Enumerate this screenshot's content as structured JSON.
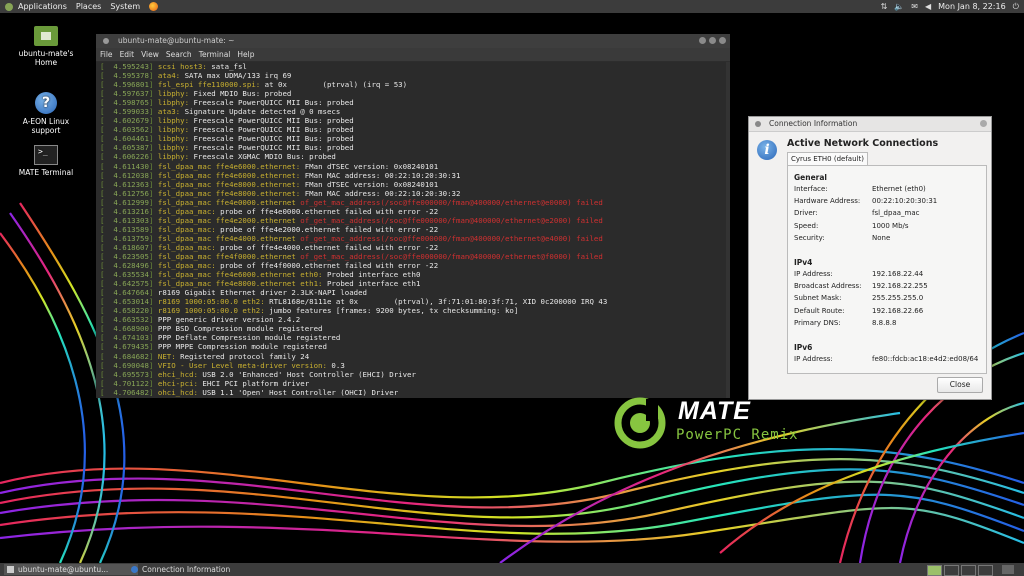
{
  "top_panel": {
    "menus": [
      "Applications",
      "Places",
      "System"
    ],
    "clock": "Mon Jan  8, 22:16"
  },
  "desktop_icons": [
    {
      "label": "ubuntu-mate's Home",
      "icon": "home-folder-icon"
    },
    {
      "label": "A-EON Linux support",
      "icon": "help-icon"
    },
    {
      "label": "MATE Terminal",
      "icon": "terminal-icon"
    }
  ],
  "terminal": {
    "title": "ubuntu-mate@ubuntu-mate: ~",
    "menu": [
      "File",
      "Edit",
      "View",
      "Search",
      "Terminal",
      "Help"
    ],
    "lines": [
      {
        "ts": "4.595243",
        "mod": "scsi host3:",
        "msg": " sata_fsl",
        "err": ""
      },
      {
        "ts": "4.595378",
        "mod": "ata4:",
        "msg": " SATA max UDMA/133 irq 69",
        "err": ""
      },
      {
        "ts": "4.596801",
        "mod": "fsl_espi ffe110000.spi:",
        "msg": " at 0x        (ptrval) (irq = 53)",
        "err": ""
      },
      {
        "ts": "4.597637",
        "mod": "libphy:",
        "msg": " Fixed MDIO Bus: probed",
        "err": ""
      },
      {
        "ts": "4.598765",
        "mod": "libphy:",
        "msg": " Freescale PowerQUICC MII Bus: probed",
        "err": ""
      },
      {
        "ts": "4.599033",
        "mod": "ata3:",
        "msg": " Signature Update detected @ 0 msecs",
        "err": ""
      },
      {
        "ts": "4.602679",
        "mod": "libphy:",
        "msg": " Freescale PowerQUICC MII Bus: probed",
        "err": ""
      },
      {
        "ts": "4.603562",
        "mod": "libphy:",
        "msg": " Freescale PowerQUICC MII Bus: probed",
        "err": ""
      },
      {
        "ts": "4.604461",
        "mod": "libphy:",
        "msg": " Freescale PowerQUICC MII Bus: probed",
        "err": ""
      },
      {
        "ts": "4.605387",
        "mod": "libphy:",
        "msg": " Freescale PowerQUICC MII Bus: probed",
        "err": ""
      },
      {
        "ts": "4.606226",
        "mod": "libphy:",
        "msg": " Freescale XGMAC MDIO Bus: probed",
        "err": ""
      },
      {
        "ts": "4.611430",
        "mod": "fsl_dpaa_mac ffe4e6000.ethernet:",
        "msg": " FMan dTSEC version: 0x08240101",
        "err": ""
      },
      {
        "ts": "4.612038",
        "mod": "fsl_dpaa_mac ffe4e6000.ethernet:",
        "msg": " FMan MAC address: 00:22:10:20:30:31",
        "err": ""
      },
      {
        "ts": "4.612363",
        "mod": "fsl_dpaa_mac ffe4e8000.ethernet:",
        "msg": " FMan dTSEC version: 0x08240101",
        "err": ""
      },
      {
        "ts": "4.612756",
        "mod": "fsl_dpaa_mac ffe4e8000.ethernet:",
        "msg": " FMan MAC address: 00:22:10:20:30:32",
        "err": ""
      },
      {
        "ts": "4.612999",
        "mod": "fsl_dpaa_mac ffe4e0000.ethernet",
        "msg": "",
        "err": " of_get_mac_address(/soc@ffe000000/fman@400000/ethernet@e0000) failed"
      },
      {
        "ts": "4.613216",
        "mod": "fsl_dpaa_mac:",
        "msg": " probe of ffe4e0000.ethernet failed with error -22",
        "err": ""
      },
      {
        "ts": "4.613303",
        "mod": "fsl_dpaa_mac ffe4e2000.ethernet",
        "msg": "",
        "err": " of_get_mac_address(/soc@ffe000000/fman@400000/ethernet@e2000) failed"
      },
      {
        "ts": "4.613589",
        "mod": "fsl_dpaa_mac:",
        "msg": " probe of ffe4e2000.ethernet failed with error -22",
        "err": ""
      },
      {
        "ts": "4.613759",
        "mod": "fsl_dpaa_mac ffe4e4000.ethernet",
        "msg": "",
        "err": " of_get_mac_address(/soc@ffe000000/fman@400000/ethernet@e4000) failed"
      },
      {
        "ts": "4.618607",
        "mod": "fsl_dpaa_mac:",
        "msg": " probe of ffe4e4000.ethernet failed with error -22",
        "err": ""
      },
      {
        "ts": "4.623505",
        "mod": "fsl_dpaa_mac ffe4f0000.ethernet",
        "msg": "",
        "err": " of_get_mac_address(/soc@ffe000000/fman@400000/ethernet@f0000) failed"
      },
      {
        "ts": "4.628496",
        "mod": "fsl_dpaa_mac:",
        "msg": " probe of ffe4f0000.ethernet failed with error -22",
        "err": ""
      },
      {
        "ts": "4.635534",
        "mod": "fsl_dpaa_mac ffe4e6000.ethernet eth0:",
        "msg": " Probed interface eth0",
        "err": ""
      },
      {
        "ts": "4.642575",
        "mod": "fsl_dpaa_mac ffe4e8000.ethernet eth1:",
        "msg": " Probed interface eth1",
        "err": ""
      },
      {
        "ts": "4.647664",
        "mod": "",
        "msg": "r8169 Gigabit Ethernet driver 2.3LK-NAPI loaded",
        "err": ""
      },
      {
        "ts": "4.653014",
        "mod": "r8169 1000:05:00.0 eth2:",
        "msg": " RTL8168e/8111e at 0x        (ptrval), 3f:71:01:80:3f:71, XID 0c200000 IRQ 43",
        "err": ""
      },
      {
        "ts": "4.658220",
        "mod": "r8169 1000:05:00.0 eth2:",
        "msg": " jumbo features [frames: 9200 bytes, tx checksumming: ko]",
        "err": ""
      },
      {
        "ts": "4.663532",
        "mod": "",
        "msg": "PPP generic driver version 2.4.2",
        "err": ""
      },
      {
        "ts": "4.668900",
        "mod": "",
        "msg": "PPP BSD Compression module registered",
        "err": ""
      },
      {
        "ts": "4.674103",
        "mod": "",
        "msg": "PPP Deflate Compression module registered",
        "err": ""
      },
      {
        "ts": "4.679435",
        "mod": "",
        "msg": "PPP MPPE Compression module registered",
        "err": ""
      },
      {
        "ts": "4.684682",
        "mod": "NET:",
        "msg": " Registered protocol family 24",
        "err": ""
      },
      {
        "ts": "4.690048",
        "mod": "VFIO - User Level meta-driver version:",
        "msg": " 0.3",
        "err": ""
      },
      {
        "ts": "4.695573",
        "mod": "ehci_hcd:",
        "msg": " USB 2.0 'Enhanced' Host Controller (EHCI) Driver",
        "err": ""
      },
      {
        "ts": "4.701122",
        "mod": "ehci-pci:",
        "msg": " EHCI PCI platform driver",
        "err": ""
      },
      {
        "ts": "4.706482",
        "mod": "ohci_hcd:",
        "msg": " USB 1.1 'Open' Host Controller (OHCI) Driver",
        "err": ""
      }
    ]
  },
  "dialog": {
    "title": "Connection Information",
    "heading": "Active Network Connections",
    "tab": "Cyrus ETH0 (default)",
    "general_label": "General",
    "general": [
      {
        "k": "Interface:",
        "v": "Ethernet (eth0)"
      },
      {
        "k": "Hardware Address:",
        "v": "00:22:10:20:30:31"
      },
      {
        "k": "Driver:",
        "v": "fsl_dpaa_mac"
      },
      {
        "k": "Speed:",
        "v": "1000 Mb/s"
      },
      {
        "k": "Security:",
        "v": "None"
      }
    ],
    "ipv4_label": "IPv4",
    "ipv4": [
      {
        "k": "IP Address:",
        "v": "192.168.22.44"
      },
      {
        "k": "Broadcast Address:",
        "v": "192.168.22.255"
      },
      {
        "k": "Subnet Mask:",
        "v": "255.255.255.0"
      },
      {
        "k": "Default Route:",
        "v": "192.168.22.66"
      },
      {
        "k": "Primary DNS:",
        "v": "8.8.8.8"
      }
    ],
    "ipv6_label": "IPv6",
    "ipv6": [
      {
        "k": "IP Address:",
        "v": "fe80::fdcb:ac18:e4d2:ed08/64"
      }
    ],
    "close_label": "Close"
  },
  "logo": {
    "word": "MATE",
    "sub": "PowerPC Remix"
  },
  "taskbar": [
    {
      "label": "ubuntu-mate@ubuntu..."
    },
    {
      "label": "Connection Information"
    }
  ]
}
